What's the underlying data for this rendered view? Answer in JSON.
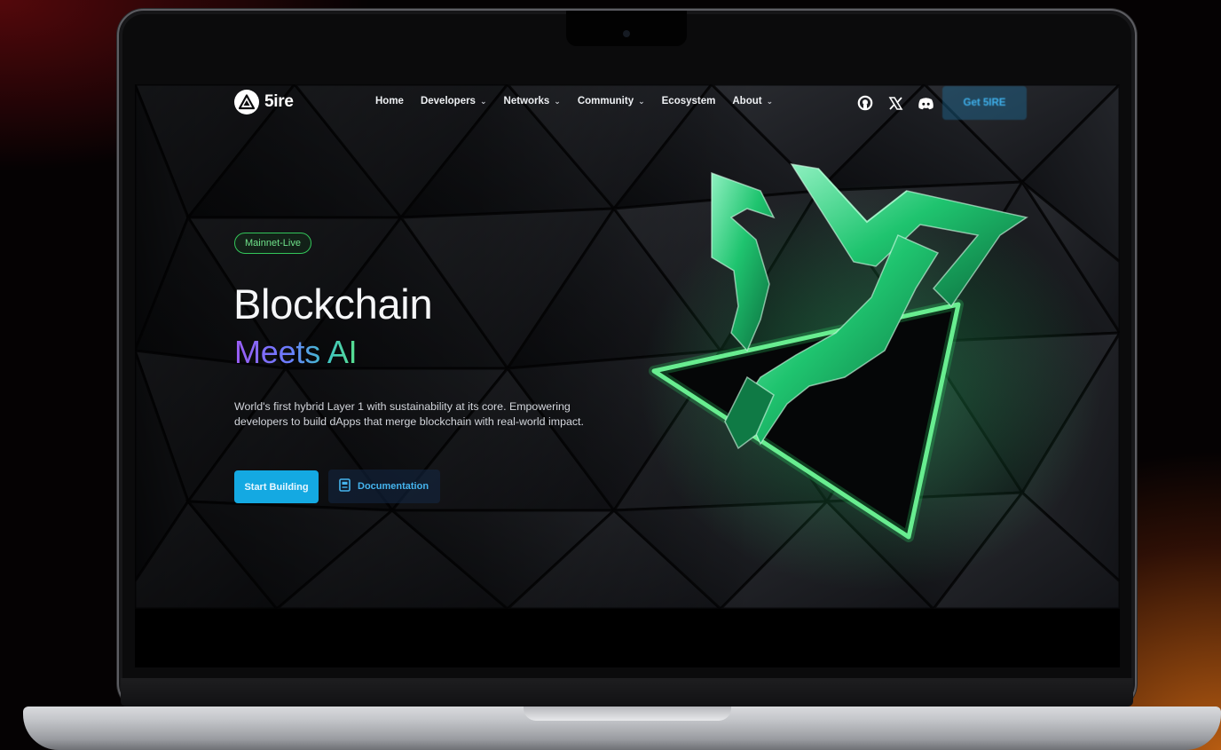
{
  "nav": {
    "logo_text": "5ire",
    "items": [
      {
        "label": "Home",
        "has_dropdown": false
      },
      {
        "label": "Developers",
        "has_dropdown": true
      },
      {
        "label": "Networks",
        "has_dropdown": true
      },
      {
        "label": "Community",
        "has_dropdown": true
      },
      {
        "label": "Ecosystem",
        "has_dropdown": false
      },
      {
        "label": "About",
        "has_dropdown": true
      }
    ],
    "social_icons": [
      "github-icon",
      "x-icon",
      "discord-icon"
    ],
    "cta_label": "Get 5IRE"
  },
  "hero": {
    "badge": "Mainnet-Live",
    "title": "Blockchain",
    "subtitle": "Meets AI",
    "description": "World's first hybrid Layer 1 with sustainability at its core. Empowering developers to build dApps that merge blockchain with real-world impact.",
    "primary_button": "Start Building",
    "secondary_button": "Documentation"
  },
  "colors": {
    "accent": "#14a9e2",
    "badge_green": "#33c65a",
    "gradient_start": "#9b5cf6",
    "gradient_end": "#58e08d"
  }
}
